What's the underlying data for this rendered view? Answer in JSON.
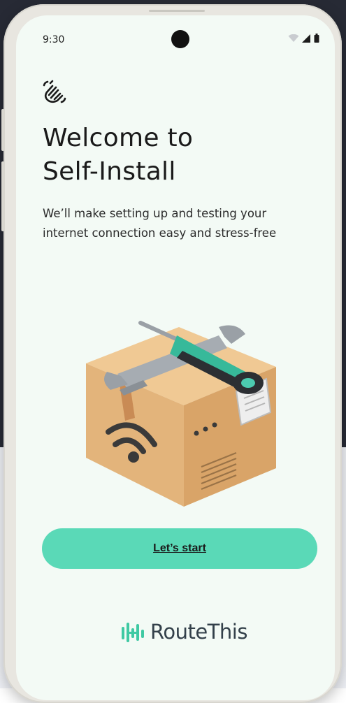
{
  "status_bar": {
    "time": "9:30"
  },
  "welcome": {
    "title_line1": "Welcome to",
    "title_line2": "Self-Install",
    "subtitle": "We’ll make setting up and testing your internet connection easy and stress-free"
  },
  "actions": {
    "start_label": "Let’s start"
  },
  "brand": {
    "name": "RouteThis"
  },
  "icons": {
    "wave": "waving-hand-icon",
    "wifi": "wifi-icon",
    "signal": "cell-signal-icon",
    "battery": "battery-icon"
  },
  "colors": {
    "screen_bg": "#f3faf5",
    "accent": "#5ad9b7",
    "brand_mark": "#3fc9a3",
    "text": "#1a1a1a"
  }
}
